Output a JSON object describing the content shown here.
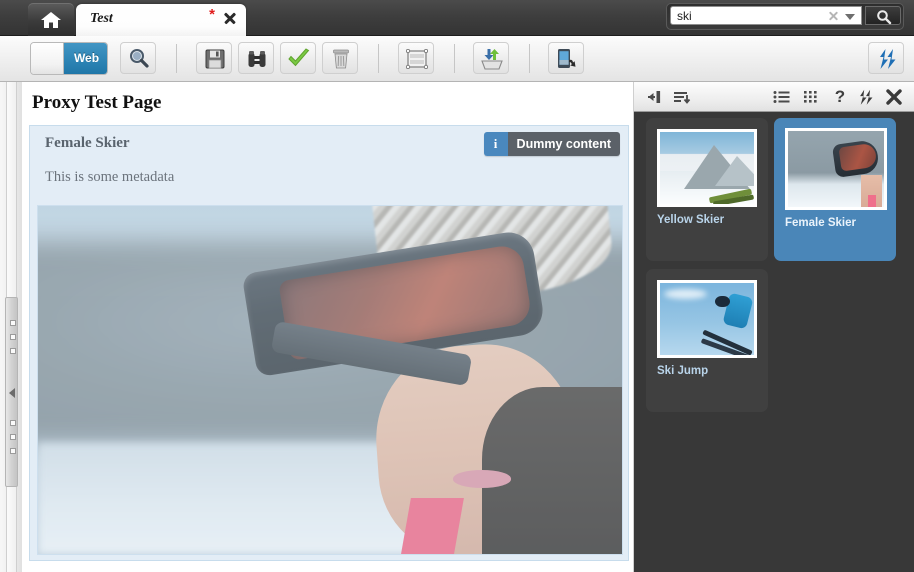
{
  "topbar": {
    "home_title": "Home",
    "tab": {
      "label": "Test",
      "dirty_marker": "*",
      "close_title": "Close tab"
    },
    "search": {
      "value": "ski",
      "placeholder": "Search",
      "clear_title": "Clear",
      "dropdown_title": "Search options",
      "go_title": "Search"
    }
  },
  "toolbar": {
    "web_toggle": {
      "label": "Web",
      "state": "on"
    },
    "buttons": [
      {
        "name": "preview-button",
        "icon": "magnifier-icon",
        "title": "Preview"
      },
      {
        "name": "save-button",
        "icon": "floppy-disk-icon",
        "title": "Save"
      },
      {
        "name": "compare-button",
        "icon": "binoculars-icon",
        "title": "Compare"
      },
      {
        "name": "approve-button",
        "icon": "green-check-icon",
        "title": "Approve"
      },
      {
        "name": "delete-button",
        "icon": "trash-can-icon",
        "title": "Delete"
      },
      {
        "name": "layout-button",
        "icon": "layout-frame-icon",
        "title": "Layout"
      },
      {
        "name": "publish-button",
        "icon": "import-export-icon",
        "title": "Publish"
      },
      {
        "name": "device-preview-button",
        "icon": "mobile-device-icon",
        "title": "Device preview"
      },
      {
        "name": "refresh-button",
        "icon": "sync-arrows-icon",
        "title": "Refresh"
      }
    ]
  },
  "splitter": {
    "collapse_title": "Collapse panel"
  },
  "content": {
    "page_title": "Proxy Test Page",
    "card": {
      "title": "Female Skier",
      "badge": {
        "icon_letter": "i",
        "label": "Dummy content"
      },
      "metadata": "This is some metadata",
      "image_alt": "Female Skier"
    }
  },
  "right_panel": {
    "toolbar_icons": [
      {
        "name": "collapse-to-left-icon",
        "title": "Collapse"
      },
      {
        "name": "sort-descending-icon",
        "title": "Sort"
      },
      {
        "name": "list-view-icon",
        "title": "List view"
      },
      {
        "name": "grid-view-icon",
        "title": "Grid view"
      },
      {
        "name": "help-icon",
        "title": "Help",
        "glyph": "?"
      },
      {
        "name": "sync-arrows-icon",
        "title": "Refresh"
      },
      {
        "name": "close-icon",
        "title": "Close"
      }
    ],
    "items": [
      {
        "label": "Yellow Skier",
        "selected": false,
        "art": "mountain"
      },
      {
        "label": "Female Skier",
        "selected": true,
        "art": "goggle"
      },
      {
        "label": "Ski Jump",
        "selected": false,
        "art": "jump"
      }
    ]
  },
  "colors": {
    "accent_blue": "#2e85b5",
    "selected_card": "#4a86b8",
    "panel_bg": "#383838",
    "card_bg": "#e3edf6",
    "badge_info": "#4a88be",
    "badge_text_bg": "#5b6168",
    "dirty_marker": "#e01b1b"
  }
}
